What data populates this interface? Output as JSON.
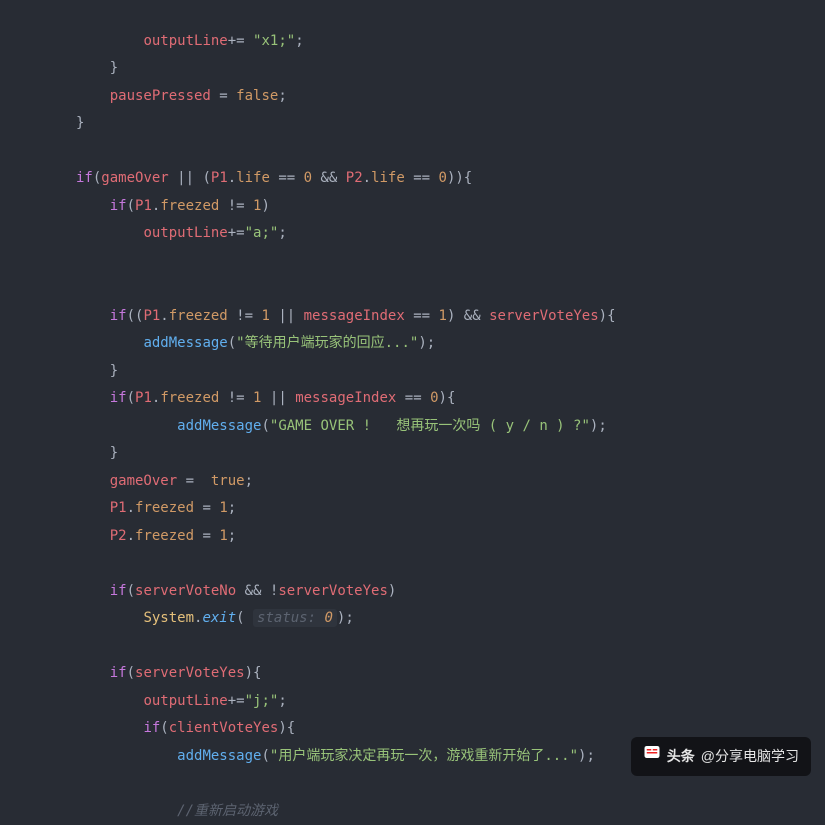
{
  "code": {
    "t1_outputLine": "outputLine",
    "t1_op": "+= ",
    "t1_str": "\"x1;\"",
    "t1_semi": ";",
    "t2_brace": "}",
    "t3_pausePressed": "pausePressed",
    "t3_eq": " = ",
    "t3_false": "false",
    "t3_semi": ";",
    "t4_brace": "}",
    "t6_if": "if",
    "t6_open": "(",
    "t6_gameOver": "gameOver",
    "t6_oror": " || (",
    "t6_P1": "P1",
    "t6_dot1": ".",
    "t6_life1": "life",
    "t6_eq1": " == ",
    "t6_zero1": "0",
    "t6_and": " && ",
    "t6_P2": "P2",
    "t6_dot2": ".",
    "t6_life2": "life",
    "t6_eq2": " == ",
    "t6_zero2": "0",
    "t6_close": ")){",
    "t7_if": "if",
    "t7_open": "(",
    "t7_P1": "P1",
    "t7_dot": ".",
    "t7_freezed": "freezed",
    "t7_ne": " != ",
    "t7_one": "1",
    "t7_close": ")",
    "t8_outputLine": "outputLine",
    "t8_op": "+=",
    "t8_str": "\"a;\"",
    "t8_semi": ";",
    "t11_if": "if",
    "t11_open": "((",
    "t11_P1": "P1",
    "t11_dot1": ".",
    "t11_freezed": "freezed",
    "t11_ne": " != ",
    "t11_one": "1",
    "t11_or": " || ",
    "t11_messageIndex": "messageIndex",
    "t11_eq": " == ",
    "t11_one2": "1",
    "t11_closeAnd": ") && ",
    "t11_serverVoteYes": "serverVoteYes",
    "t11_close": "){",
    "t12_addMessage": "addMessage",
    "t12_open": "(",
    "t12_str": "\"等待用户端玩家的回应...\"",
    "t12_close": ");",
    "t13_brace": "}",
    "t14_if": "if",
    "t14_open": "(",
    "t14_P1": "P1",
    "t14_dot": ".",
    "t14_freezed": "freezed",
    "t14_ne": " != ",
    "t14_one": "1",
    "t14_or": " || ",
    "t14_messageIndex": "messageIndex",
    "t14_eq": " == ",
    "t14_zero": "0",
    "t14_close": "){",
    "t15_addMessage": "addMessage",
    "t15_open": "(",
    "t15_str": "\"GAME OVER !   想再玩一次吗 ( y / n ) ?\"",
    "t15_close": ");",
    "t16_brace": "}",
    "t17_gameOver": "gameOver",
    "t17_eq": " =  ",
    "t17_true": "true",
    "t17_semi": ";",
    "t18_P1": "P1",
    "t18_dot": ".",
    "t18_freezed": "freezed",
    "t18_eq": " = ",
    "t18_one": "1",
    "t18_semi": ";",
    "t19_P2": "P2",
    "t19_dot": ".",
    "t19_freezed": "freezed",
    "t19_eq": " = ",
    "t19_one": "1",
    "t19_semi": ";",
    "t21_if": "if",
    "t21_open": "(",
    "t21_serverVoteNo": "serverVoteNo",
    "t21_and": " && !",
    "t21_serverVoteYes": "serverVoteYes",
    "t21_close": ")",
    "t22_System": "System",
    "t22_dot": ".",
    "t22_exit": "exit",
    "t22_open": "( ",
    "t22_hint": "status: ",
    "t22_zero": "0",
    "t22_close": ");",
    "t24_if": "if",
    "t24_open": "(",
    "t24_serverVoteYes": "serverVoteYes",
    "t24_close": "){",
    "t25_outputLine": "outputLine",
    "t25_op": "+=",
    "t25_str": "\"j;\"",
    "t25_semi": ";",
    "t26_if": "if",
    "t26_open": "(",
    "t26_clientVoteYes": "clientVoteYes",
    "t26_close": "){",
    "t27_addMessage": "addMessage",
    "t27_open": "(",
    "t27_str": "\"用户端玩家决定再玩一次，游戏重新开始了...\"",
    "t27_close": ");",
    "t29_comment": "//重新启动游戏"
  },
  "watermark": {
    "prefix": "头条",
    "text": " @分享电脑学习"
  }
}
